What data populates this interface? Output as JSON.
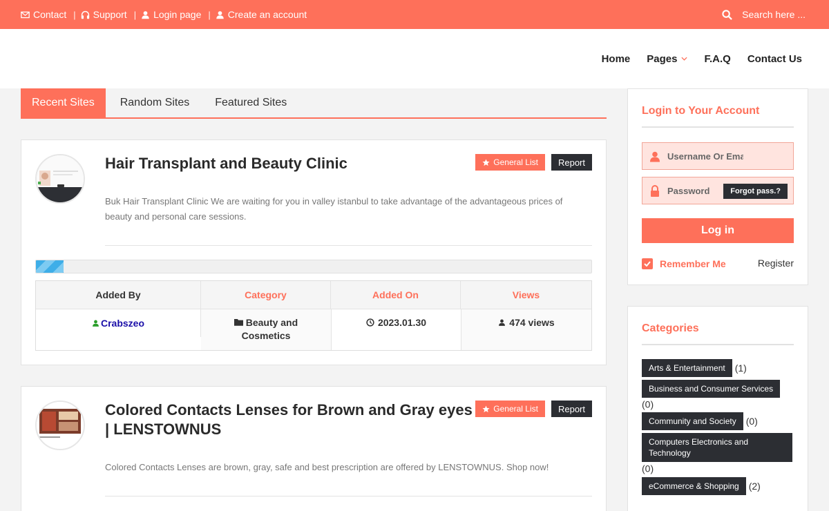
{
  "topbar": {
    "links": [
      {
        "label": "Contact",
        "icon": "envelope-icon"
      },
      {
        "label": "Support",
        "icon": "headphones-icon"
      },
      {
        "label": "Login page",
        "icon": "user-icon"
      },
      {
        "label": "Create an account",
        "icon": "user-icon"
      }
    ],
    "search_placeholder": "Search here ...",
    "accent": "#fe705a"
  },
  "nav": {
    "items": [
      "Home",
      "Pages",
      "F.A.Q",
      "Contact Us"
    ]
  },
  "tabs": [
    "Recent Sites",
    "Random Sites",
    "Featured Sites"
  ],
  "listings": [
    {
      "title": "Hair Transplant and Beauty Clinic",
      "badge_general": "General List",
      "badge_report": "Report",
      "description": "Buk Hair Transplant Clinic We are waiting for you in valley istanbul to take advantage of the advantageous prices of beauty and personal care sessions.",
      "progress": 0.05,
      "meta_headers": [
        "Added By",
        "Category",
        "Added On",
        "Views"
      ],
      "added_by": "Crabszeo",
      "category": "Beauty and Cosmetics",
      "added_on": "2023.01.30",
      "views": "474 views"
    },
    {
      "title": "Colored Contacts Lenses for Brown and Gray eyes | LENSTOWNUS",
      "badge_general": "General List",
      "badge_report": "Report",
      "description": "Colored Contacts Lenses are brown, gray, safe and best prescription are offered by LENSTOWNUS. Shop now!"
    }
  ],
  "login": {
    "title": "Login to Your Account",
    "username_placeholder": "Username Or Email",
    "password_placeholder": "Password",
    "forgot": "Forgot pass.?",
    "button": "Log in",
    "remember": "Remember Me",
    "register": "Register"
  },
  "categories": {
    "title": "Categories",
    "items": [
      {
        "name": "Arts & Entertainment",
        "count": "(1)"
      },
      {
        "name": "Business and Consumer Services",
        "count": "(0)"
      },
      {
        "name": "Community and Society",
        "count": "(0)"
      },
      {
        "name": "Computers Electronics and Technology",
        "count": "(0)"
      },
      {
        "name": "eCommerce & Shopping",
        "count": "(2)"
      }
    ]
  }
}
